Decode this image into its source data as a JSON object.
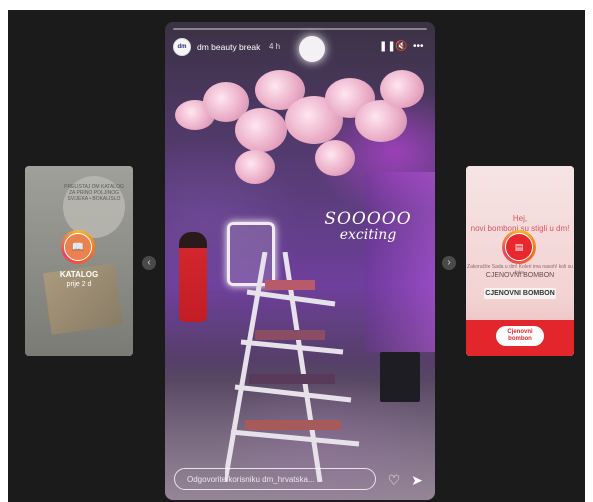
{
  "story": {
    "account": "dm beauty break",
    "time": "4 h",
    "sticker_line1": "SOOOOO",
    "sticker_line2": "exciting",
    "reply_placeholder": "Odgovorite korisniku dm_hrvatska..."
  },
  "left_preview": {
    "user": "KATALOG",
    "time": "prije 2 d",
    "promo_lines": "PRELISTAJ dm KATALOG ZA PRINO POLJINOG SVIJEKA • BOKALISLO"
  },
  "right_preview": {
    "headline": "Hej,",
    "subline": "novi bomboni su stigli u dm!",
    "small_text": "Zakoračite Sada u dm! Koleri ima nasoh! koli su take.",
    "label1": "CJENOVNI BOMBON",
    "label2": "CJENOVNI BOMBON",
    "candy": "Cjenovni bombon"
  },
  "colors": {
    "viewer_bg": "#1b1b1b",
    "accent_red": "#e2262c",
    "purple_glow": "#d646f5"
  },
  "icons": {
    "pause": "pause-icon",
    "mute": "mute-icon",
    "more": "more-icon",
    "heart": "heart-icon",
    "send": "send-icon",
    "prev": "chevron-left-icon",
    "next": "chevron-right-icon"
  }
}
